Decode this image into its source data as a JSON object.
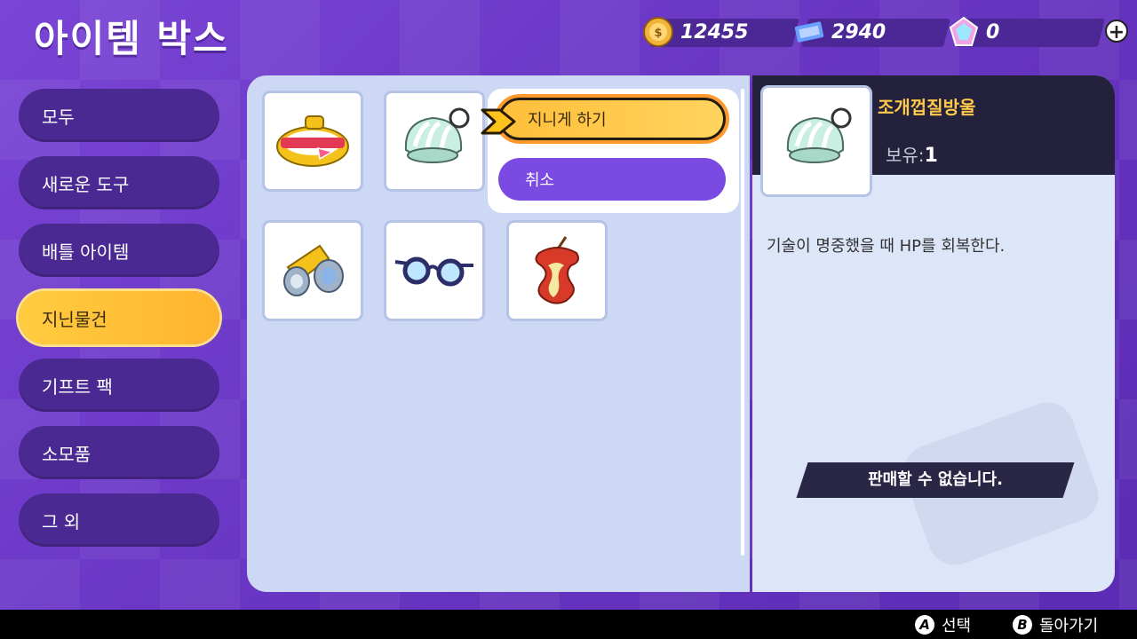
{
  "header": {
    "title": "아이템 박스",
    "currencies": [
      {
        "icon": "coin-icon",
        "value": "12455"
      },
      {
        "icon": "ticket-icon",
        "value": "2940"
      },
      {
        "icon": "gem-icon",
        "value": "0"
      }
    ],
    "plus_label": "+"
  },
  "sidebar": {
    "items": [
      {
        "label": "모두"
      },
      {
        "label": "새로운 도구"
      },
      {
        "label": "배틀 아이템"
      },
      {
        "label": "지닌물건",
        "active": true
      },
      {
        "label": "기프트 팩"
      },
      {
        "label": "소모품"
      },
      {
        "label": "그 외"
      }
    ]
  },
  "grid": {
    "items": [
      {
        "icon": "muscle-band-icon"
      },
      {
        "icon": "shell-bell-icon"
      },
      {
        "icon": "scope-lens-icon"
      },
      {
        "icon": "wise-glasses-icon"
      },
      {
        "icon": "apple-core-icon"
      }
    ]
  },
  "popup": {
    "confirm_label": "지니게 하기",
    "cancel_label": "취소"
  },
  "detail": {
    "name": "조개껍질방울",
    "owned_label": "보유:",
    "owned_count": "1",
    "description": "기술이 명중했을 때 HP를 회복한다.",
    "sell_notice": "판매할 수 없습니다."
  },
  "footer": {
    "select_key": "A",
    "select_label": "선택",
    "back_key": "B",
    "back_label": "돌아가기"
  }
}
